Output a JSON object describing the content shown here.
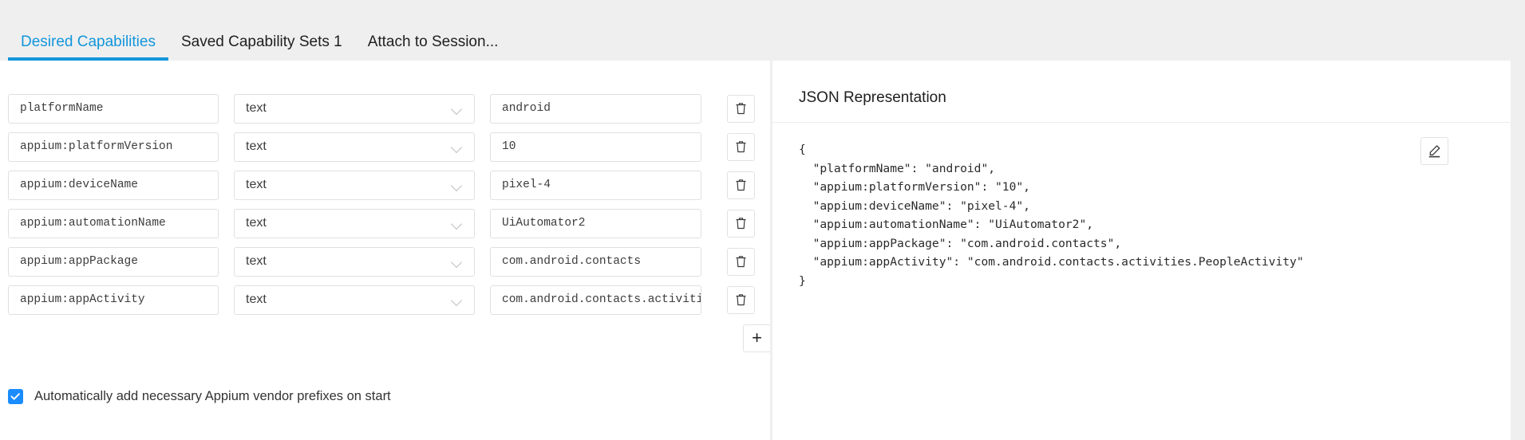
{
  "tabs": [
    {
      "label": "Desired Capabilities",
      "active": true
    },
    {
      "label": "Saved Capability Sets 1",
      "active": false
    },
    {
      "label": "Attach to Session...",
      "active": false
    }
  ],
  "capabilities": {
    "rows": [
      {
        "name": "platformName",
        "type": "text",
        "value": "android"
      },
      {
        "name": "appium:platformVersion",
        "type": "text",
        "value": "10"
      },
      {
        "name": "appium:deviceName",
        "type": "text",
        "value": "pixel-4"
      },
      {
        "name": "appium:automationName",
        "type": "text",
        "value": "UiAutomator2"
      },
      {
        "name": "appium:appPackage",
        "type": "text",
        "value": "com.android.contacts"
      },
      {
        "name": "appium:appActivity",
        "type": "text",
        "value": "com.android.contacts.activities.PeopleActivity"
      }
    ],
    "delete_label": "trash-icon",
    "add_label": "+"
  },
  "vendor_prefix": {
    "label": "Automatically add necessary Appium vendor prefixes on start",
    "checked": true
  },
  "json_panel": {
    "title": "JSON Representation",
    "content": "{\n  \"platformName\": \"android\",\n  \"appium:platformVersion\": \"10\",\n  \"appium:deviceName\": \"pixel-4\",\n  \"appium:automationName\": \"UiAutomator2\",\n  \"appium:appPackage\": \"com.android.contacts\",\n  \"appium:appActivity\": \"com.android.contacts.activities.PeopleActivity\"\n}",
    "edit_label": "edit-icon"
  },
  "colors": {
    "accent": "#1296db",
    "checkbox": "#1a8cff",
    "page_bg": "#efefef",
    "panel_bg": "#ffffff"
  }
}
